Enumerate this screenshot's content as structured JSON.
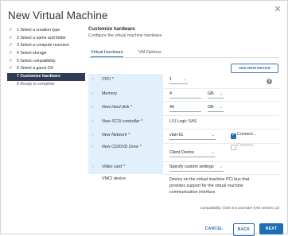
{
  "window": {
    "title": "New Virtual Machine",
    "close_glyph": "✕"
  },
  "steps": [
    {
      "label": "1 Select a creation type",
      "state": "done"
    },
    {
      "label": "2 Select a name and folder",
      "state": "done"
    },
    {
      "label": "3 Select a compute resource",
      "state": "done"
    },
    {
      "label": "4 Select storage",
      "state": "done"
    },
    {
      "label": "5 Select compatibility",
      "state": "done"
    },
    {
      "label": "6 Select a guest OS",
      "state": "done"
    },
    {
      "label": "7 Customize hardware",
      "state": "active"
    },
    {
      "label": "8 Ready to complete",
      "state": "pending"
    }
  ],
  "section": {
    "title": "Customize hardware",
    "subtitle": "Configure the virtual machine hardware"
  },
  "tabs": [
    {
      "label": "Virtual Hardware",
      "active": true
    },
    {
      "label": "VM Options",
      "active": false
    }
  ],
  "add_device_label": "ADD NEW DEVICE",
  "hardware": {
    "cpu": {
      "label": "CPU *",
      "value": "1"
    },
    "memory": {
      "label": "Memory",
      "value": "4",
      "unit": "GB"
    },
    "hard_disk": {
      "label": "New Hard disk *",
      "value": "40",
      "unit": "GB"
    },
    "scsi": {
      "label": "New SCSI controller *",
      "value": "LSI Logic SAS"
    },
    "network": {
      "label": "New Network *",
      "value": "vlan-61",
      "connect_label": "Connect...",
      "connect_checked": true
    },
    "cd_dvd": {
      "label": "New CD/DVD Drive *",
      "value": "Client Device",
      "connect_label": "Connect...",
      "connect_checked": false
    },
    "video": {
      "label": "Video card *",
      "value": "Specify custom settings"
    },
    "vmci": {
      "label": "VMCI device",
      "desc_line1": "Device on the virtual machine PCI bus that",
      "desc_line2": "provides support for the virtual machine",
      "desc_line3": "communication interface"
    }
  },
  "compatibility": "Compatibility: ESXi 6.5 and later (VM version 13)",
  "buttons": {
    "cancel": "CANCEL",
    "back": "BACK",
    "next": "NEXT"
  },
  "glyphs": {
    "check": "✓",
    "chevron_right": "›",
    "caret_down": "⌄",
    "info": "i"
  },
  "colors": {
    "accent": "#2a6cb8",
    "active_step": "#2f3b55",
    "label_bg": "#e1f0fb"
  }
}
